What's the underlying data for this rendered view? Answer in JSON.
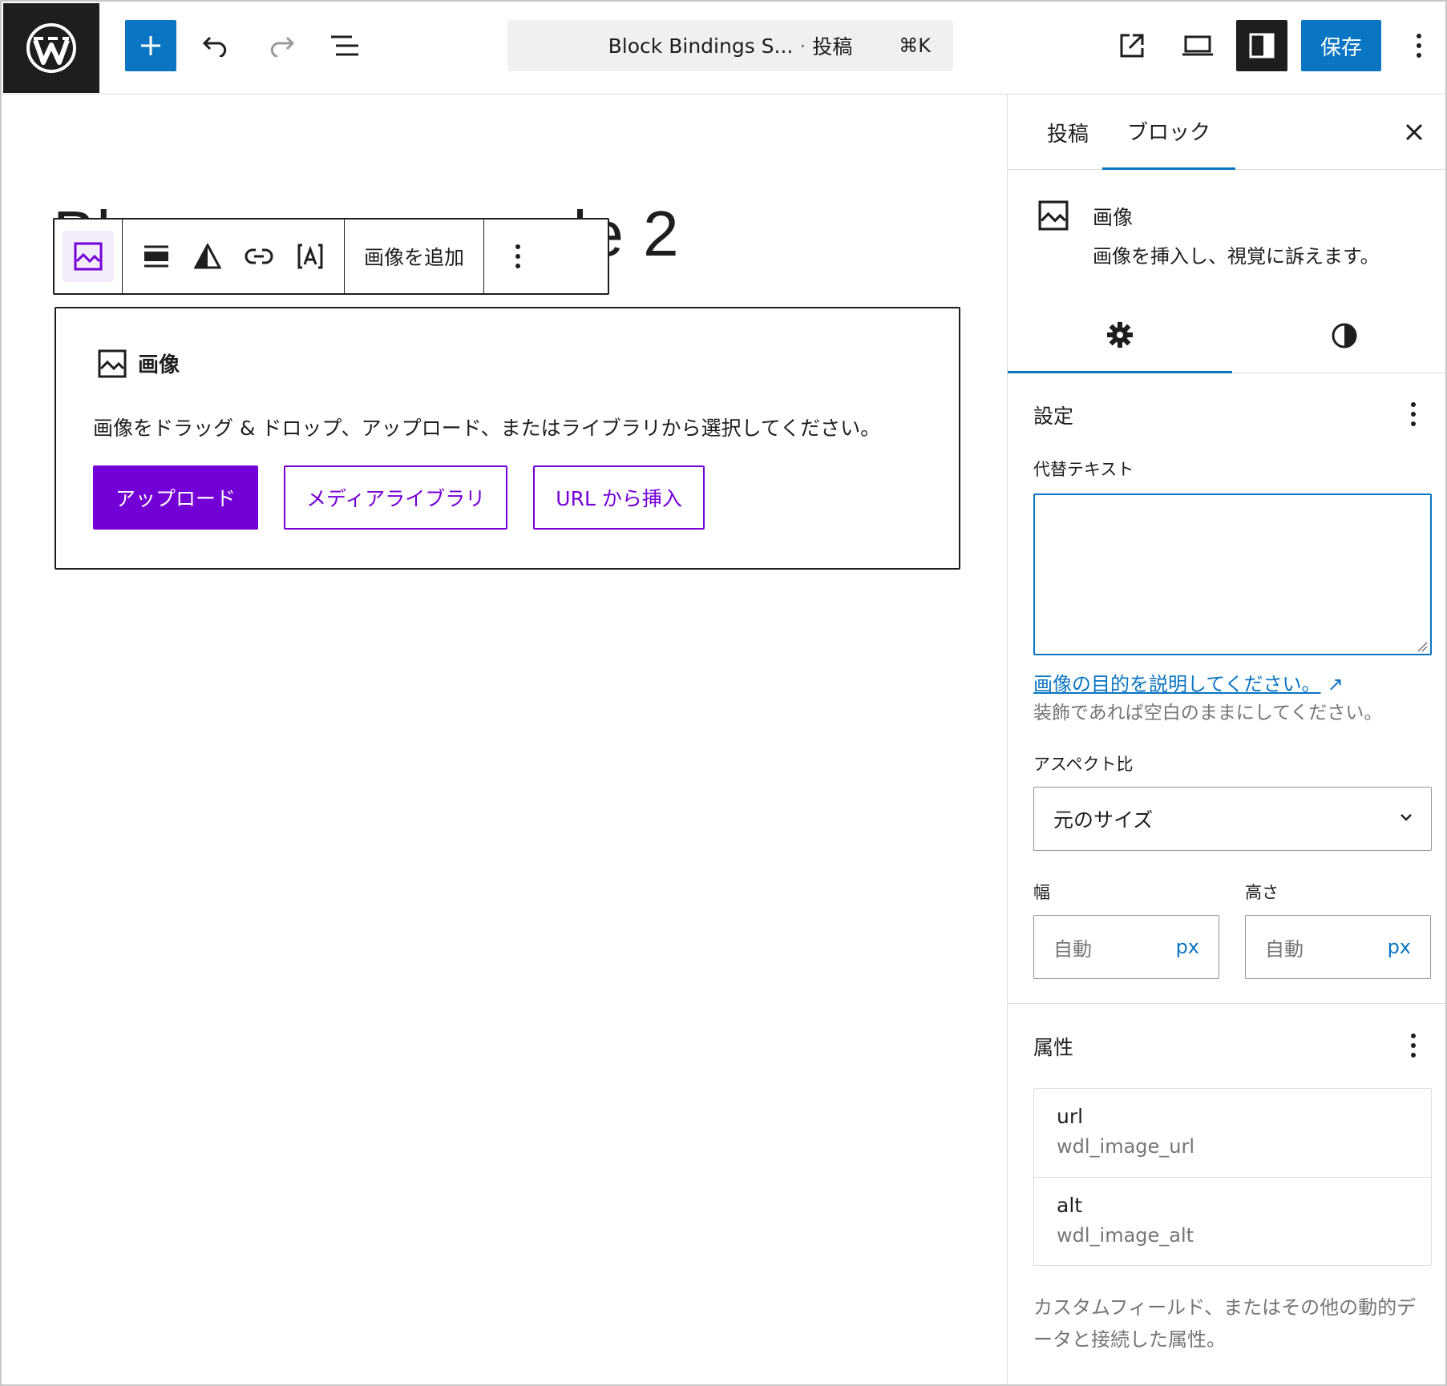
{
  "topbar": {
    "document_title": "Block Bindings S...",
    "document_separator": "·",
    "document_type": "投稿",
    "shortcut": "⌘K",
    "save_label": "保存"
  },
  "editor": {
    "post_title_left": "Bl",
    "post_title_right": "ple 2",
    "toolbar": {
      "add_image_label": "画像を追加"
    },
    "placeholder": {
      "title": "画像",
      "description": "画像をドラッグ & ドロップ、アップロード、またはライブラリから選択してください。",
      "upload_label": "アップロード",
      "media_library_label": "メディアライブラリ",
      "insert_url_label": "URL から挿入"
    }
  },
  "sidebar": {
    "tabs": [
      "投稿",
      "ブロック"
    ],
    "active_tab": "ブロック",
    "block_card": {
      "title": "画像",
      "description": "画像を挿入し、視覚に訴えます。"
    },
    "settings_panel": {
      "title": "設定",
      "alt_text_label": "代替テキスト",
      "alt_text_value": "",
      "alt_link": "画像の目的を説明してください。",
      "alt_help": "装飾であれば空白のままにしてください。",
      "aspect_ratio_label": "アスペクト比",
      "aspect_ratio_value": "元のサイズ",
      "width_label": "幅",
      "height_label": "高さ",
      "width_placeholder": "自動",
      "height_placeholder": "自動",
      "unit": "px"
    },
    "attributes_panel": {
      "title": "属性",
      "items": [
        {
          "name": "url",
          "value": "wdl_image_url"
        },
        {
          "name": "alt",
          "value": "wdl_image_alt"
        }
      ],
      "help": "カスタムフィールド、またはその他の動的データと接続した属性。"
    }
  },
  "colors": {
    "accent": "#0a75c2",
    "admin_purple": "#7400d8",
    "dark": "#1e1e1e"
  }
}
